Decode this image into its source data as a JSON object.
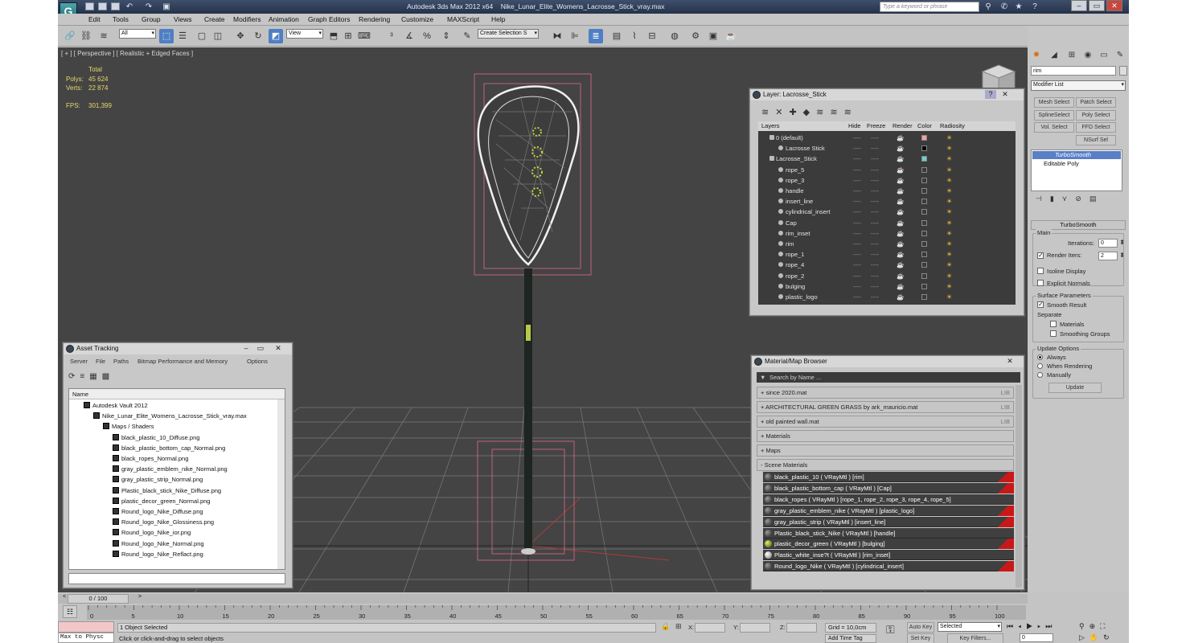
{
  "app": {
    "title": "Autodesk 3ds Max  2012 x64",
    "file": "Nike_Lunar_Elite_Womens_Lacrosse_Stick_vray.max",
    "search_placeholder": "Type a keyword or phrase"
  },
  "menu": [
    "Edit",
    "Tools",
    "Group",
    "Views",
    "Create",
    "Modifiers",
    "Animation",
    "Graph Editors",
    "Rendering",
    "Customize",
    "MAXScript",
    "Help"
  ],
  "toolbar": {
    "selection_filter": "All",
    "reference_coord": "View",
    "named_selection": "Create Selection S"
  },
  "viewport": {
    "label": "[ + ] [ Perspective ] [ Realistic + Edged Faces ]",
    "stats": {
      "total_label": "Total",
      "polys_label": "Polys:",
      "polys": "45 624",
      "verts_label": "Verts:",
      "verts": "22 874",
      "fps_label": "FPS:",
      "fps": "301,399"
    }
  },
  "layer_window": {
    "title": "Layer: Lacrosse_Stick",
    "columns": [
      "Layers",
      "Hide",
      "Freeze",
      "Render",
      "Color",
      "Radiosity"
    ],
    "rows": [
      {
        "name": "0 (default)",
        "indent": 0,
        "color": "#f4a0a0"
      },
      {
        "name": "Lacrosse Stick",
        "indent": 1,
        "color": "#000000"
      },
      {
        "name": "Lacrosse_Stick",
        "indent": 0,
        "color": "#6fd0c8"
      },
      {
        "name": "rope_5",
        "indent": 1
      },
      {
        "name": "rope_3",
        "indent": 1
      },
      {
        "name": "handle",
        "indent": 1
      },
      {
        "name": "insert_line",
        "indent": 1
      },
      {
        "name": "cylindrical_insert",
        "indent": 1
      },
      {
        "name": "Cap",
        "indent": 1
      },
      {
        "name": "rim_inset",
        "indent": 1
      },
      {
        "name": "rim",
        "indent": 1
      },
      {
        "name": "rope_1",
        "indent": 1
      },
      {
        "name": "rope_4",
        "indent": 1
      },
      {
        "name": "rope_2",
        "indent": 1
      },
      {
        "name": "bulging",
        "indent": 1
      },
      {
        "name": "plastic_logo",
        "indent": 1
      }
    ]
  },
  "asset_window": {
    "title": "Asset Tracking",
    "menu": [
      "Server",
      "File",
      "Paths",
      "Bitmap Performance and Memory",
      "Options"
    ],
    "column": "Name",
    "tree": [
      {
        "name": "Autodesk Vault 2012",
        "indent": 1
      },
      {
        "name": "Nike_Lunar_Elite_Womens_Lacrosse_Stick_vray.max",
        "indent": 2
      },
      {
        "name": "Maps / Shaders",
        "indent": 3
      },
      {
        "name": "black_plastic_10_Diffuse.png",
        "indent": 4
      },
      {
        "name": "black_plastic_bottom_cap_Normal.png",
        "indent": 4
      },
      {
        "name": "black_ropes_Normal.png",
        "indent": 4
      },
      {
        "name": "gray_plastic_emblem_nike_Normal.png",
        "indent": 4
      },
      {
        "name": "gray_plastic_strip_Normal.png",
        "indent": 4
      },
      {
        "name": "Plastic_black_stick_Nike_Diffuse.png",
        "indent": 4
      },
      {
        "name": "plastic_decor_green_Normal.png",
        "indent": 4
      },
      {
        "name": "Round_logo_Nike_Diffuse.png",
        "indent": 4
      },
      {
        "name": "Round_logo_Nike_Glossiness.png",
        "indent": 4
      },
      {
        "name": "Round_logo_Nike_ior.png",
        "indent": 4
      },
      {
        "name": "Round_logo_Nike_Normal.png",
        "indent": 4
      },
      {
        "name": "Round_logo_Nike_Reflact.png",
        "indent": 4
      }
    ]
  },
  "material_window": {
    "title": "Material/Map Browser",
    "search_placeholder": "Search by Name ...",
    "libraries": [
      {
        "name": "+ since 2020.mat",
        "tag": "LIB"
      },
      {
        "name": "+ ARCHITECTURAL GREEN GRASS by ark_mauricio.mat",
        "tag": "LIB"
      },
      {
        "name": "+ old painted wall.mat",
        "tag": "LIB"
      },
      {
        "name": "+ Materials",
        "tag": ""
      },
      {
        "name": "+ Maps",
        "tag": ""
      },
      {
        "name": "- Scene Materials",
        "tag": ""
      }
    ],
    "scene_materials": [
      "black_plastic_10  ( VRayMtl ) [rim]",
      "black_plastic_bottom_cap  ( VRayMtl ) [Cap]",
      "black_ropes  ( VRayMtl ) [rope_1, rope_2, rope_3, rope_4, rope_5]",
      "gray_plastic_emblem_nike  ( VRayMtl ) [plastic_logo]",
      "gray_plastic_strip  ( VRayMtl ) [insert_line]",
      "Plastic_black_stick_Nike  ( VRayMtl ) [handle]",
      "plastic_decor_green  ( VRayMtl ) [bulging]",
      "Plastic_white_inse?t  ( VRayMtl ) [rim_inset]",
      "Round_logo_Nike  ( VRayMtl ) [cylindrical_insert]"
    ]
  },
  "command_panel": {
    "object_name": "rim",
    "modifier_list": "Modifier List",
    "buttons": [
      "Mesh Select",
      "Patch Select",
      "SplineSelect",
      "Poly Select",
      "Vol. Select",
      "FFD Select",
      "NSurf Sel"
    ],
    "stack": [
      "TurboSmooth",
      "Editable Poly"
    ],
    "rollout_title": "TurboSmooth",
    "main_label": "Main",
    "iterations_label": "Iterations:",
    "iterations": "0",
    "render_iters_label": "Render Iters:",
    "render_iters": "2",
    "isoline_label": "Isoline Display",
    "explicit_label": "Explicit Normals",
    "surface_label": "Surface Parameters",
    "smooth_result_label": "Smooth Result",
    "separate_label": "Separate",
    "materials_label": "Materials",
    "smoothing_groups_label": "Smoothing Groups",
    "update_options_label": "Update Options",
    "always_label": "Always",
    "when_rendering_label": "When Rendering",
    "manually_label": "Manually",
    "update_button": "Update"
  },
  "timeline": {
    "frame": "0 / 100",
    "ticks": [
      "0",
      "5",
      "10",
      "15",
      "20",
      "25",
      "30",
      "35",
      "40",
      "45",
      "50",
      "55",
      "60",
      "65",
      "70",
      "75",
      "80",
      "85",
      "90",
      "95",
      "100"
    ]
  },
  "status": {
    "maxscript": "Max to Physc",
    "selected": "1 Object Selected",
    "prompt": "Click or click-and-drag to select objects",
    "x_label": "X:",
    "y_label": "Y:",
    "z_label": "Z:",
    "grid": "Grid = 10,0cm",
    "add_time_tag": "Add Time Tag",
    "auto_key": "Auto Key",
    "auto_key_value": "Selected",
    "set_key": "Set Key",
    "key_filters": "Key Filters...",
    "frame_field": "0"
  }
}
